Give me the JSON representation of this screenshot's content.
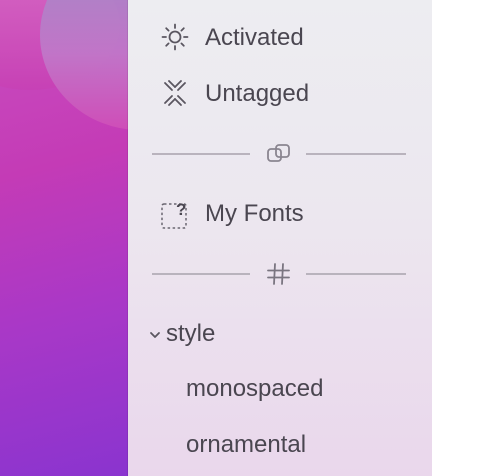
{
  "sidebar": {
    "items": [
      {
        "label": "Activated",
        "icon": "sun-icon"
      },
      {
        "label": "Untagged",
        "icon": "tag-x-icon"
      }
    ],
    "divider_1_icon": "duplicate-icon",
    "my_fonts": {
      "label": "My Fonts",
      "icon": "dashed-folder-question-icon"
    },
    "divider_2_icon": "hashtag-icon",
    "group": {
      "label": "style",
      "expanded": true,
      "children": [
        {
          "label": "monospaced"
        },
        {
          "label": "ornamental"
        }
      ]
    }
  },
  "colors": {
    "text": "#4a4650",
    "icon": "#5a5660",
    "divider": "#b9b3bd"
  }
}
